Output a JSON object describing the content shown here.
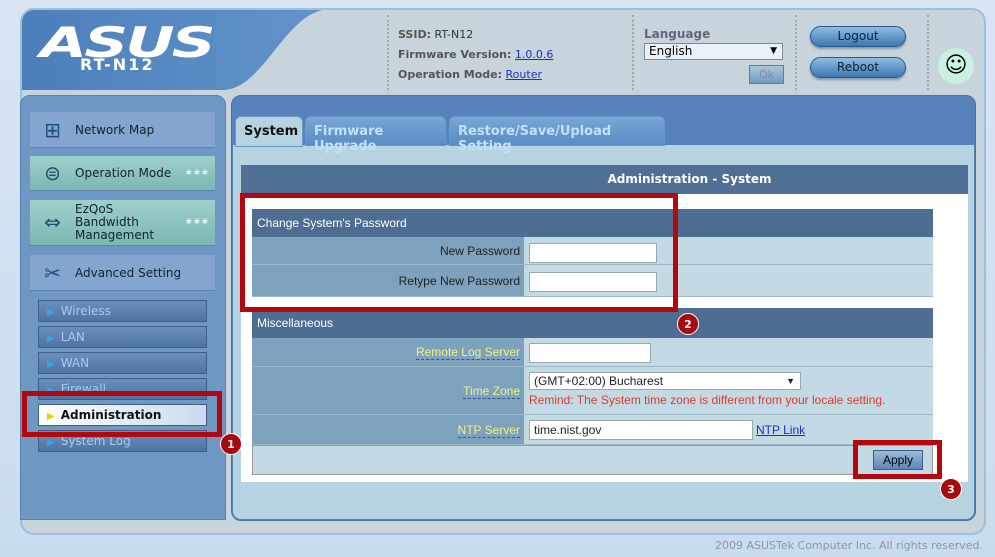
{
  "header": {
    "brand": "ASUS",
    "model": "RT-N12",
    "ssid_label": "SSID:",
    "ssid": "RT-N12",
    "firmware_label": "Firmware Version:",
    "firmware": "1.0.0.6",
    "mode_label": "Operation Mode:",
    "mode": "Router",
    "language_label": "Language",
    "language": "English",
    "ok_label": "Ok",
    "logout": "Logout",
    "reboot": "Reboot"
  },
  "sidebar": {
    "items": [
      {
        "label": "Network Map"
      },
      {
        "label": "Operation Mode"
      },
      {
        "label": "EzQoS Bandwidth Management"
      },
      {
        "label": "Advanced Setting"
      }
    ],
    "sub": [
      "Wireless",
      "LAN",
      "WAN",
      "Firewall",
      "Administration",
      "System Log"
    ]
  },
  "tabs": [
    "System",
    "Firmware Upgrade",
    "Restore/Save/Upload Setting"
  ],
  "main": {
    "title": "Administration - System",
    "password_section": "Change System's Password",
    "new_password": "New Password",
    "retype_password": "Retype New Password",
    "misc_section": "Miscellaneous",
    "remote_log": "Remote Log Server",
    "time_zone": "Time Zone",
    "time_zone_value": "(GMT+02:00) Bucharest",
    "remind": "Remind: The System time zone is different from your locale setting.",
    "ntp_server": "NTP Server",
    "ntp_value": "time.nist.gov",
    "ntp_link": "NTP Link",
    "apply": "Apply",
    "help": "?"
  },
  "annotations": [
    "1",
    "2",
    "3"
  ],
  "footer": "2009 ASUSTek Computer Inc. All rights reserved.",
  "colors": {
    "annotation": "#b4060d",
    "header_bar": "#4f6f95"
  }
}
